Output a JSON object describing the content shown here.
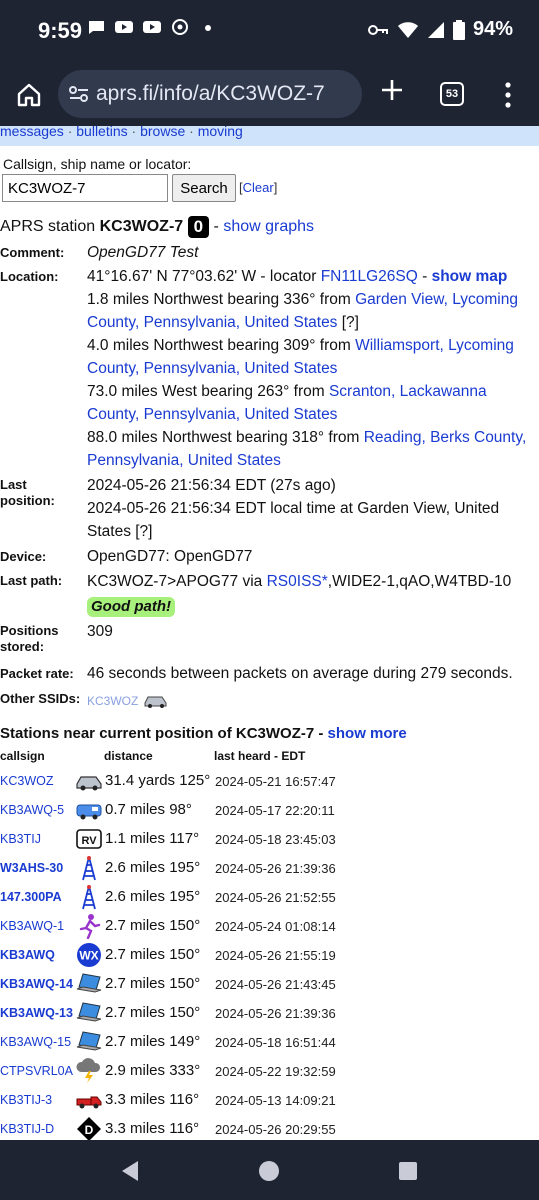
{
  "status": {
    "time": "9:59",
    "battery": "94%"
  },
  "browser": {
    "url": "aprs.fi/info/a/KC3WOZ-7",
    "tab_count": "53"
  },
  "topnav": [
    "messages",
    "bulletins",
    "browse",
    "moving"
  ],
  "search": {
    "label": "Callsign, ship name or locator:",
    "value": "KC3WOZ-7",
    "button": "Search",
    "clear_prefix": "[",
    "clear": "Clear",
    "clear_suffix": "]"
  },
  "station": {
    "prefix": "APRS station ",
    "callsign": "KC3WOZ-7",
    "badge": "0",
    "dash": " - ",
    "graphs": "show graphs"
  },
  "details": {
    "comment_label": "Comment:",
    "comment": "OpenGD77 Test",
    "location_label": "Location:",
    "coords": "41°16.67' N 77°03.62' W - locator ",
    "locator": "FN11LG26SQ",
    "sep": " - ",
    "show_map": "show map",
    "places": [
      {
        "text": "1.8 miles Northwest bearing 336° from ",
        "link": "Garden View, Lycoming County, Pennsylvania, United States",
        "suffix": " [?]"
      },
      {
        "text": "4.0 miles Northwest bearing 309° from ",
        "link": "Williamsport, Lycoming County, Pennsylvania, United States",
        "suffix": ""
      },
      {
        "text": "73.0 miles West bearing 263° from ",
        "link": "Scranton, Lackawanna County, Pennsylvania, United States",
        "suffix": ""
      },
      {
        "text": "88.0 miles Northwest bearing 318° from ",
        "link": "Reading, Berks County, Pennsylvania, United States",
        "suffix": ""
      }
    ],
    "lastpos_label": "Last position:",
    "lastpos1": "2024-05-26 21:56:34 EDT (27s ago)",
    "lastpos2": "2024-05-26 21:56:34 EDT local time at Garden View, United States [?]",
    "device_label": "Device:",
    "device": "OpenGD77: OpenGD77",
    "path_label": "Last path:",
    "path_pre": "KC3WOZ-7>APOG77 via ",
    "path_link": "RS0ISS*",
    "path_post": ",WIDE2-1,qAO,W4TBD-10",
    "good_path": "Good path!",
    "positions_label": "Positions stored:",
    "positions": "309",
    "rate_label": "Packet rate:",
    "rate": "46 seconds between packets on average during 279 seconds.",
    "ssids_label": "Other SSIDs:",
    "ssid": "KC3WOZ"
  },
  "near": {
    "prefix": "Stations near current position of ",
    "callsign": "KC3WOZ-7",
    "dash": " - ",
    "more": "show more",
    "col_callsign": "callsign",
    "col_distance": "distance",
    "col_heard": "last heard - EDT",
    "rows": [
      {
        "call": "KC3WOZ",
        "icon": "car-icon",
        "dist": "31.4 yards 125°",
        "time": "2024-05-21 16:57:47",
        "bold": false
      },
      {
        "call": "KB3AWQ-5",
        "icon": "van-icon",
        "dist": "0.7 miles 98°",
        "time": "2024-05-17 22:20:11",
        "bold": false
      },
      {
        "call": "KB3TIJ",
        "icon": "rv-icon",
        "dist": "1.1 miles 117°",
        "time": "2024-05-18 23:45:03",
        "bold": false
      },
      {
        "call": "W3AHS-30",
        "icon": "tower-icon",
        "dist": "2.6 miles 195°",
        "time": "2024-05-26 21:39:36",
        "bold": true
      },
      {
        "call": "147.300PA",
        "icon": "tower-icon",
        "dist": "2.6 miles 195°",
        "time": "2024-05-26 21:52:55",
        "bold": true
      },
      {
        "call": "KB3AWQ-1",
        "icon": "runner-icon",
        "dist": "2.7 miles 150°",
        "time": "2024-05-24 01:08:14",
        "bold": false
      },
      {
        "call": "KB3AWQ",
        "icon": "wx-icon",
        "dist": "2.7 miles 150°",
        "time": "2024-05-26 21:55:19",
        "bold": true
      },
      {
        "call": "KB3AWQ-14",
        "icon": "laptop-icon",
        "dist": "2.7 miles 150°",
        "time": "2024-05-26 21:43:45",
        "bold": true
      },
      {
        "call": "KB3AWQ-13",
        "icon": "laptop-icon",
        "dist": "2.7 miles 150°",
        "time": "2024-05-26 21:39:36",
        "bold": true
      },
      {
        "call": "KB3AWQ-15",
        "icon": "laptop-icon",
        "dist": "2.7 miles 149°",
        "time": "2024-05-18 16:51:44",
        "bold": false
      },
      {
        "call": "CTPSVRL0A",
        "icon": "storm-icon",
        "dist": "2.9 miles 333°",
        "time": "2024-05-22 19:32:59",
        "bold": false
      },
      {
        "call": "KB3TIJ-3",
        "icon": "truck-icon",
        "dist": "3.3 miles 116°",
        "time": "2024-05-13 14:09:21",
        "bold": false
      },
      {
        "call": "KB3TIJ-D",
        "icon": "dstar-icon",
        "dist": "3.3 miles 116°",
        "time": "2024-05-26 20:29:55",
        "bold": false
      }
    ]
  }
}
